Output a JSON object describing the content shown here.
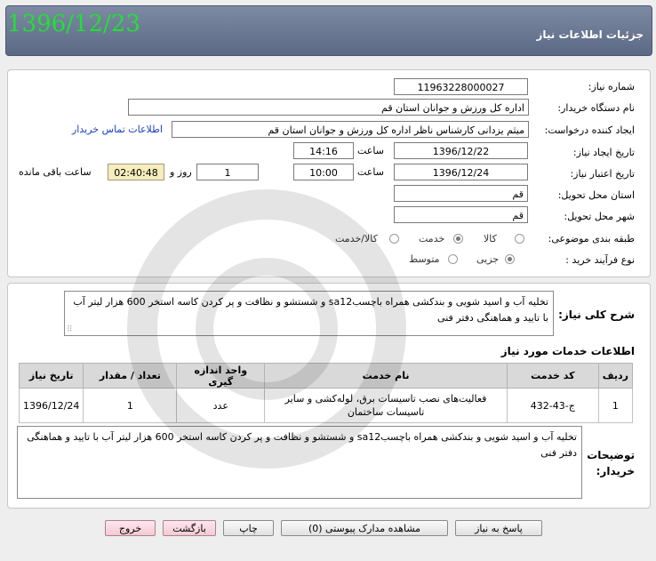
{
  "header": {
    "title": "جزئیات اطلاعات نیاز",
    "date_overlay": "1396/12/23"
  },
  "form": {
    "need_number": {
      "label": "شماره نیاز:",
      "value": "1196322800002‌7"
    },
    "buyer_org": {
      "label": "نام دستگاه خریدار:",
      "value": "اداره کل ورزش و جوانان استان قم"
    },
    "requester": {
      "label": "ایجاد کننده درخواست:",
      "value": "میثم یزدانی کارشناس ناظر اداره کل ورزش و جوانان استان قم",
      "contact_link": "اطلاعات تماس خریدار"
    },
    "created": {
      "label": "تاریخ ایجاد نیاز:",
      "date": "1396/12/22",
      "time_label": "ساعت",
      "time": "14:16"
    },
    "validity": {
      "label": "تاریخ اعتبار نیاز:",
      "date": "1396/12/24",
      "time_label": "ساعت",
      "time": "10:00",
      "days": "1",
      "days_label": "روز و",
      "remaining": "02:40:48",
      "remaining_label": "ساعت باقی مانده"
    },
    "province": {
      "label": "استان محل تحویل:",
      "value": "قم"
    },
    "city": {
      "label": "شهر محل تحویل:",
      "value": "قم"
    },
    "category": {
      "label": "طبقه بندی موضوعی:",
      "options": [
        "کالا",
        "خدمت",
        "کالا/خدمت"
      ],
      "selected": "خدمت"
    },
    "process": {
      "label": "نوع فرآیند خرید :",
      "options": [
        "جزیی",
        "متوسط"
      ],
      "selected": "جزیی"
    }
  },
  "summary": {
    "label": "شرح کلی نیاز:",
    "text": "تخلیه آب و اسید شویی و بندکشی همراه باچسبsa12 و شستشو و نظافت و پر کردن کاسه استخر 600 هزار لیتر آب با تایید و هماهنگی دفتر فنی"
  },
  "services": {
    "title": "اطلاعات خدمات مورد نیاز",
    "columns": [
      "ردیف",
      "کد خدمت",
      "نام خدمت",
      "واحد اندازه گیری",
      "تعداد / مقدار",
      "تاریخ نیاز"
    ],
    "rows": [
      [
        "1",
        "ج-43-432",
        "فعالیت‌های نصب تاسیسات برق، لوله‌کشی و سایر تاسیسات ساختمان",
        "عدد",
        "1",
        "1396/12/24"
      ]
    ]
  },
  "buyer_notes": {
    "label": "توضیحات خریدار:",
    "text": "تخلیه آب و اسید شویی و بندکشی همراه باچسبsa12 و شستشو و نظافت و پر کردن کاسه استخر 600 هزار لیتر آب با تایید و هماهنگی دفتر فنی"
  },
  "buttons": {
    "reply": "پاسخ به نیاز",
    "attachments": "مشاهده مدارک پیوستی (0)",
    "print": "چاپ",
    "back": "بازگشت",
    "exit": "خروج"
  }
}
